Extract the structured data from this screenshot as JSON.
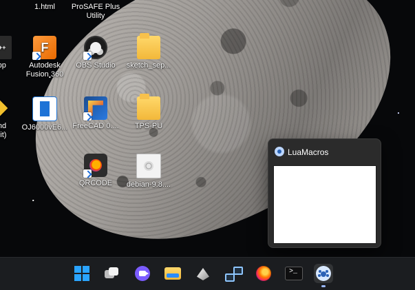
{
  "desktop": {
    "background_desc": "",
    "icons": [
      {
        "label": "1.html",
        "semantic": "html-file-icon"
      },
      {
        "label": "ProSAFE Plus\nUtility",
        "semantic": "prosafe-utility-icon"
      },
      {
        "label": "cpp",
        "semantic": "cpp-file-icon"
      },
      {
        "label": "Autodesk\nFusion 360",
        "semantic": "autodesk-fusion-icon"
      },
      {
        "label": "OBS Studio",
        "semantic": "obs-studio-icon"
      },
      {
        "label": "sketch_sep...",
        "semantic": "folder-icon"
      },
      {
        "label": "ond\n-bit)",
        "semantic": "app-shortcut-icon"
      },
      {
        "label": "OJ6000vE6...",
        "semantic": "oj-file-icon"
      },
      {
        "label": "FreeCAD 0....",
        "semantic": "freecad-icon"
      },
      {
        "label": "TPS-PU",
        "semantic": "folder-icon"
      },
      {
        "label": "QRCODE",
        "semantic": "qrcode-icon"
      },
      {
        "label": "debian-9.8....",
        "semantic": "disc-image-icon"
      }
    ]
  },
  "popup": {
    "title": "LuaMacros"
  },
  "taskbar": {
    "items": [
      {
        "name": "Start",
        "icon": "windows-logo-icon"
      },
      {
        "name": "Task View",
        "icon": "task-view-icon"
      },
      {
        "name": "Meet",
        "icon": "meet-icon"
      },
      {
        "name": "File Explorer",
        "icon": "file-explorer-icon"
      },
      {
        "name": "App",
        "icon": "pyramid-icon"
      },
      {
        "name": "Network",
        "icon": "network-icon"
      },
      {
        "name": "Firefox",
        "icon": "firefox-icon"
      },
      {
        "name": "Terminal",
        "icon": "terminal-icon"
      },
      {
        "name": "LuaMacros",
        "icon": "luamacros-icon",
        "active": true
      }
    ]
  }
}
